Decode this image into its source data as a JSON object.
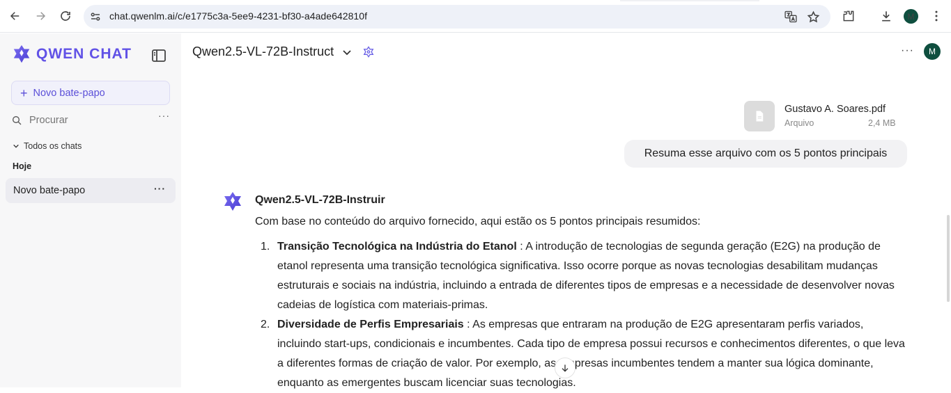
{
  "browser": {
    "url": "chat.qwenlm.ai/c/e1775c3a-5ee9-4231-bf30-a4ade642810f",
    "profile_initial": "M"
  },
  "sidebar": {
    "logo_text": "QWEN CHAT",
    "new_chat_label": "Novo bate-papo",
    "search_placeholder": "Procurar",
    "search_more": "···",
    "all_chats_label": "Todos os chats",
    "group_today": "Hoje",
    "items": [
      {
        "label": "Novo bate-papo",
        "more": "···"
      }
    ]
  },
  "header": {
    "model_name": "Qwen2.5-VL-72B-Instruct",
    "more": "···",
    "avatar_initial": "M"
  },
  "attachment": {
    "file_name": "Gustavo A. Soares.pdf",
    "file_type": "Arquivo",
    "file_size": "2,4 MB"
  },
  "user_message": "Resuma esse arquivo com os 5 pontos principais",
  "assistant": {
    "name": "Qwen2.5-VL-72B-Instruir",
    "intro": "Com base no conteúdo do arquivo fornecido, aqui estão os 5 pontos principais resumidos:",
    "points": [
      {
        "num": "1.",
        "head": "Transição Tecnológica na Indústria do Etanol",
        "text": " : A introdução de tecnologias de segunda geração (E2G) na produção de etanol representa uma transição tecnológica significativa. Isso ocorre porque as novas tecnologias desabilitam mudanças estruturais e sociais na indústria, incluindo a entrada de diferentes tipos de empresas e a necessidade de desenvolver novas cadeias de logística com materiais-primas."
      },
      {
        "num": "2.",
        "head": "Diversidade de Perfis Empresariais",
        "text": " : As empresas que entraram na produção de E2G apresentaram perfis variados, incluindo start-ups, condicionais e incumbentes. Cada tipo de empresa possui recursos e conhecimentos diferentes, o que leva a diferentes formas de criação de valor. Por exemplo, as empresas incumbentes tendem a manter sua lógica dominante, enquanto as emergentes buscam licenciar suas tecnologias."
      }
    ]
  },
  "colors": {
    "brand": "#6152e6",
    "sidebar_bg": "#f7f7f8",
    "bubble_bg": "#f2f2f4",
    "avatar_bg": "#0f4f3f"
  }
}
